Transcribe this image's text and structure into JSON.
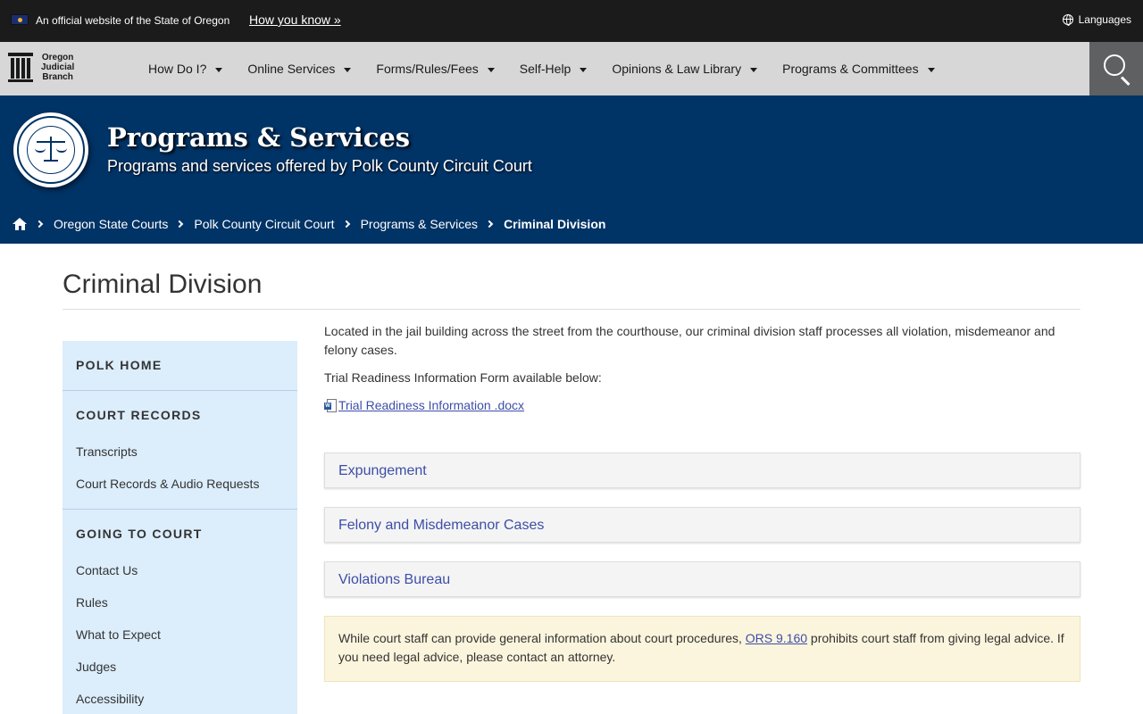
{
  "official_banner": {
    "text": "An official website of the State of Oregon",
    "how_you_know": "How you know »",
    "languages": "Languages"
  },
  "nav": {
    "logo": {
      "line1": "Oregon",
      "line2": "Judicial",
      "line3": "Branch"
    },
    "items": [
      {
        "label": "How Do I?"
      },
      {
        "label": "Online Services"
      },
      {
        "label": "Forms/Rules/Fees"
      },
      {
        "label": "Self-Help"
      },
      {
        "label": "Opinions & Law Library"
      },
      {
        "label": "Programs & Committees"
      }
    ]
  },
  "hero": {
    "title": "Programs & Services",
    "subtitle": "Programs and services offered by Polk County Circuit Court"
  },
  "breadcrumb": {
    "items": [
      "Oregon State Courts",
      "Polk County Circuit Court",
      "Programs & Services"
    ],
    "current": "Criminal Division"
  },
  "page": {
    "title": "Criminal Division"
  },
  "sidebar": {
    "sections": [
      {
        "heading": "POLK HOME",
        "links": []
      },
      {
        "heading": "COURT RECORDS",
        "links": [
          "Transcripts",
          "Court Records & Audio Requests"
        ]
      },
      {
        "heading": "GOING TO COURT",
        "links": [
          "Contact Us",
          "Rules",
          "What to Expect",
          "Judges",
          "Accessibility"
        ]
      }
    ]
  },
  "content": {
    "intro": "Located in the jail building across the street from the courthouse, our criminal division staff processes all violation, misdemeanor and felony cases.",
    "form_note": "Trial Readiness Information Form available below:",
    "doc_link": "Trial Readiness Information .docx",
    "accordions": [
      "Expungement",
      "Felony and Misdemeanor Cases",
      "Violations Bureau"
    ],
    "notice": {
      "before": "While court staff can provide general information about court procedures, ",
      "link": "ORS 9.160",
      "after": " prohibits court staff from giving legal advice. If you need legal advice, please contact an attorney."
    }
  },
  "colors": {
    "hero_bg": "#003366",
    "nav_bg": "#d7d7d7",
    "sidebar_bg": "#dcedfc",
    "link": "#3d4ea8",
    "notice_bg": "#fcf5dd"
  }
}
